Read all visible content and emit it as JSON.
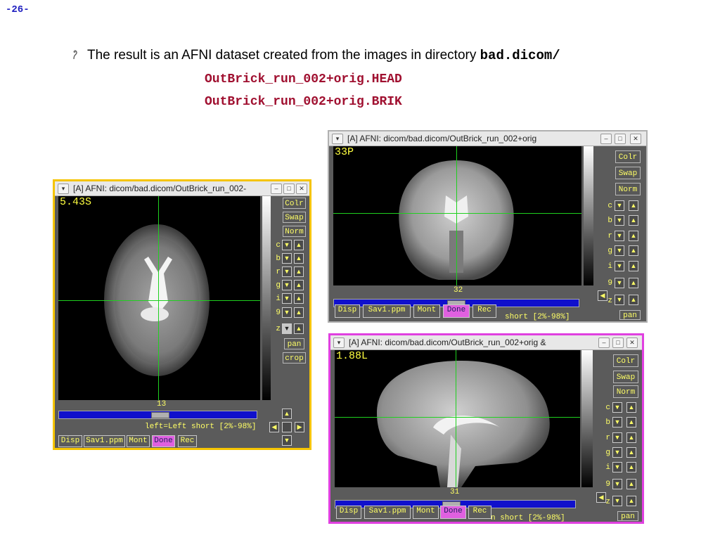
{
  "page": {
    "number": "-26-"
  },
  "text": {
    "bullet": "The result is an AFNI dataset created from the images in directory",
    "directory": "bad.dicom/",
    "files": [
      "OutBrick_run_002+orig.HEAD",
      "OutBrick_run_002+orig.BRIK"
    ]
  },
  "windows": {
    "axial": {
      "title": "[A] AFNI: dicom/bad.dicom/OutBrick_run_002-",
      "coord": "5.43S",
      "slice": "13",
      "status": "left=Left short [2%-98%]",
      "frame_color": "#f5c400"
    },
    "coronal": {
      "title": "[A] AFNI: dicom/bad.dicom/OutBrick_run_002+orig",
      "coord": "33P",
      "slice": "32",
      "status": "short [2%-98%]",
      "frame_color": "#b0b0b0"
    },
    "sagittal": {
      "title": "[A] AFNI: dicom/bad.dicom/OutBrick_run_002+orig &",
      "coord": "1.88L",
      "slice": "31",
      "status": "n short [2%-98%]",
      "frame_color": "#e040e0"
    }
  },
  "controls": {
    "colr": "Colr",
    "swap": "Swap",
    "norm": "Norm",
    "pan": "pan",
    "crop": "crop",
    "rows": [
      "c",
      "b",
      "r",
      "g",
      "i",
      "9",
      "z"
    ]
  },
  "buttons": {
    "disp": "Disp",
    "save": "Sav1.ppm",
    "mont": "Mont",
    "done": "Done",
    "rec": "Rec"
  },
  "icons": {
    "menu": "chevron-down-icon",
    "minimize": "minimize-icon",
    "maximize": "maximize-icon",
    "close": "close-icon",
    "up": "arrow-up-icon",
    "down": "arrow-down-icon",
    "left": "arrow-left-icon",
    "right": "arrow-right-icon"
  }
}
